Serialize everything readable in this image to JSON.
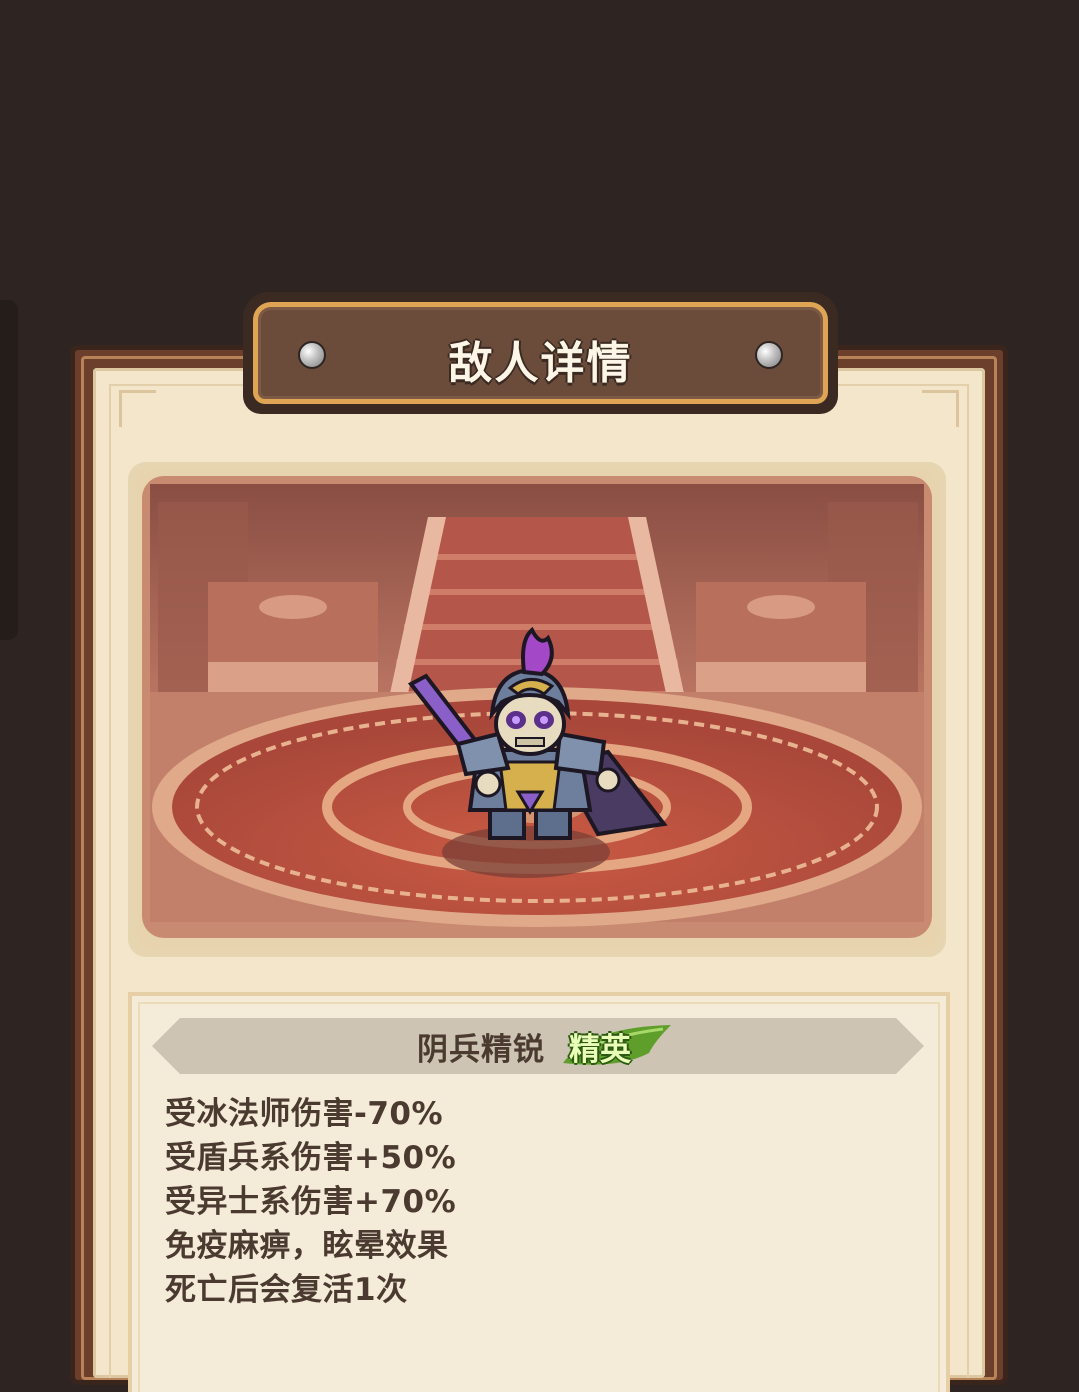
{
  "panel": {
    "title": "敌人详情"
  },
  "enemy": {
    "name": "阴兵精锐",
    "rank_badge": "精英",
    "traits": [
      "受冰法师伤害-70%",
      "受盾兵系伤害+50%",
      "受异士系伤害+70%",
      "免疫麻痹，眩晕效果",
      "死亡后会复活1次"
    ]
  },
  "colors": {
    "background": "#2e2522",
    "frame": "#6b3f2b",
    "parchment": "#f3e6cb",
    "title_gold": "#e0a554",
    "elite_green": "#5f9e2a",
    "text_brown": "#4a3a30"
  },
  "icons": [
    "rivet-icon",
    "skeleton-general-sprite"
  ]
}
